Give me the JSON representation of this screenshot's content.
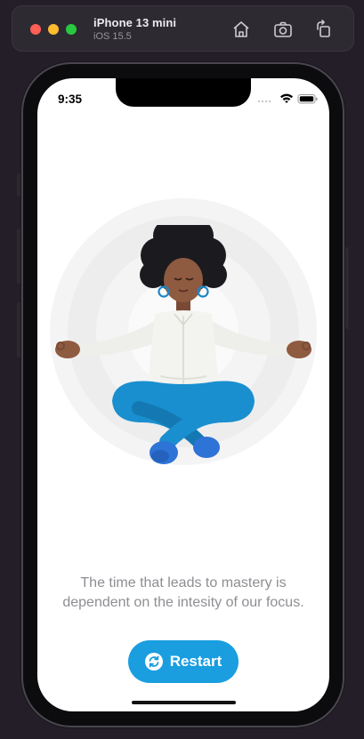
{
  "simulator": {
    "device_name": "iPhone 13 mini",
    "os_version": "iOS 15.5",
    "toolbar_icons": [
      "home-icon",
      "screenshot-icon",
      "rotate-icon"
    ]
  },
  "status_bar": {
    "time": "9:35",
    "icons": [
      "signal-icon",
      "wifi-icon",
      "battery-icon"
    ]
  },
  "illustration": {
    "subject": "meditating-person-illustration",
    "ring_color": "#f2f2f2"
  },
  "quote": {
    "text": "The time that leads to mastery is dependent on the intesity of our focus."
  },
  "restart_button": {
    "label": "Restart",
    "icon": "refresh-icon",
    "color": "#1a9ee0"
  }
}
